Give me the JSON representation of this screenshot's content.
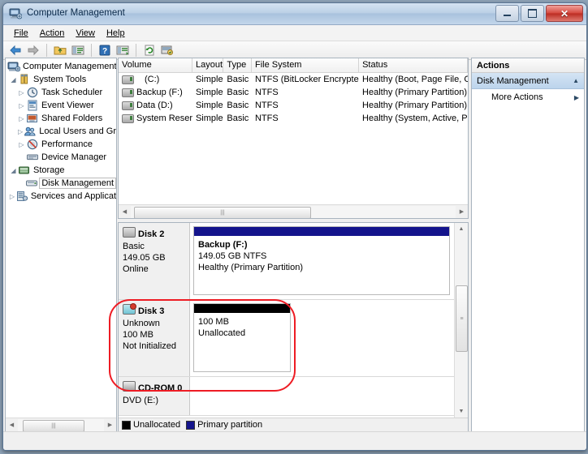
{
  "window": {
    "title": "Computer Management",
    "icon": "computer-management-icon",
    "buttons": {
      "minimize": "minimize",
      "maximize": "maximize",
      "close": "✕"
    }
  },
  "menu": {
    "items": [
      "File",
      "Action",
      "View",
      "Help"
    ]
  },
  "toolbar": {
    "items": [
      {
        "name": "back-icon",
        "glyph": "←"
      },
      {
        "name": "forward-icon",
        "glyph": "→"
      },
      {
        "name": "up-folder-icon",
        "glyph": "▤"
      },
      {
        "name": "show-hide-console-tree-icon",
        "glyph": "▦"
      },
      {
        "name": "help-icon",
        "glyph": "?"
      },
      {
        "name": "properties-icon",
        "glyph": "▦"
      },
      {
        "name": "refresh-icon",
        "glyph": "⟳"
      },
      {
        "name": "rescan-disks-icon",
        "glyph": "▩"
      }
    ]
  },
  "tree": {
    "items": [
      {
        "label": "Computer Management",
        "level": 0,
        "expander": "",
        "icon": "computer-icon",
        "selected": false
      },
      {
        "label": "System Tools",
        "level": 1,
        "expander": "▲",
        "icon": "system-tools-icon",
        "selected": false
      },
      {
        "label": "Task Scheduler",
        "level": 2,
        "expander": "▶",
        "icon": "clock-icon",
        "selected": false
      },
      {
        "label": "Event Viewer",
        "level": 2,
        "expander": "▶",
        "icon": "event-viewer-icon",
        "selected": false
      },
      {
        "label": "Shared Folders",
        "level": 2,
        "expander": "▶",
        "icon": "shared-folders-icon",
        "selected": false
      },
      {
        "label": "Local Users and Gr",
        "level": 2,
        "expander": "▶",
        "icon": "users-icon",
        "selected": false
      },
      {
        "label": "Performance",
        "level": 2,
        "expander": "▶",
        "icon": "performance-icon",
        "selected": false
      },
      {
        "label": "Device Manager",
        "level": 2,
        "expander": "",
        "icon": "device-manager-icon",
        "selected": false
      },
      {
        "label": "Storage",
        "level": 1,
        "expander": "▲",
        "icon": "storage-icon",
        "selected": false
      },
      {
        "label": "Disk Management",
        "level": 2,
        "expander": "",
        "icon": "disk-management-icon",
        "selected": true
      },
      {
        "label": "Services and Applicat",
        "level": 1,
        "expander": "▶",
        "icon": "services-icon",
        "selected": false
      }
    ]
  },
  "volume_list": {
    "columns": [
      "Volume",
      "Layout",
      "Type",
      "File System",
      "Status"
    ],
    "rows": [
      {
        "volume": "(C:)",
        "layout": "Simple",
        "type": "Basic",
        "filesystem": "NTFS (BitLocker Encrypted)",
        "status": "Healthy (Boot, Page File, Cra",
        "indent": true
      },
      {
        "volume": "Backup (F:)",
        "layout": "Simple",
        "type": "Basic",
        "filesystem": "NTFS",
        "status": "Healthy (Primary Partition)",
        "indent": false
      },
      {
        "volume": "Data (D:)",
        "layout": "Simple",
        "type": "Basic",
        "filesystem": "NTFS",
        "status": "Healthy (Primary Partition)",
        "indent": false
      },
      {
        "volume": "System Reserved",
        "layout": "Simple",
        "type": "Basic",
        "filesystem": "NTFS",
        "status": "Healthy (System, Active, Prin",
        "indent": false
      }
    ]
  },
  "graphical_view": {
    "disks": [
      {
        "name": "Disk 2",
        "icon": "disk-icon",
        "lines": [
          "Basic",
          "149.05 GB",
          "Online"
        ],
        "partition": {
          "bar_color": "#14148c",
          "title": "Backup  (F:)",
          "size": "149.05 GB NTFS",
          "status": "Healthy (Primary Partition)"
        }
      },
      {
        "name": "Disk 3",
        "icon": "disk-error-icon",
        "lines": [
          "Unknown",
          "100 MB",
          "Not Initialized"
        ],
        "partition": {
          "bar_color": "#000000",
          "title": "",
          "size": "100 MB",
          "status": "Unallocated"
        }
      },
      {
        "name": "CD-ROM 0",
        "icon": "cdrom-icon",
        "lines": [
          "DVD (E:)"
        ],
        "partition": null
      }
    ]
  },
  "legend": {
    "items": [
      {
        "label": "Unallocated",
        "color": "#000000"
      },
      {
        "label": "Primary partition",
        "color": "#14148c"
      }
    ]
  },
  "actions": {
    "title": "Actions",
    "header": {
      "label": "Disk Management",
      "collapse_glyph": "▲"
    },
    "items": [
      {
        "label": "More Actions",
        "submenu_glyph": "▶"
      }
    ]
  },
  "scrollbars": {
    "left_arrow": "◀",
    "right_arrow": "▶",
    "up_arrow": "▲",
    "down_arrow": "▼",
    "grip": "|||"
  }
}
